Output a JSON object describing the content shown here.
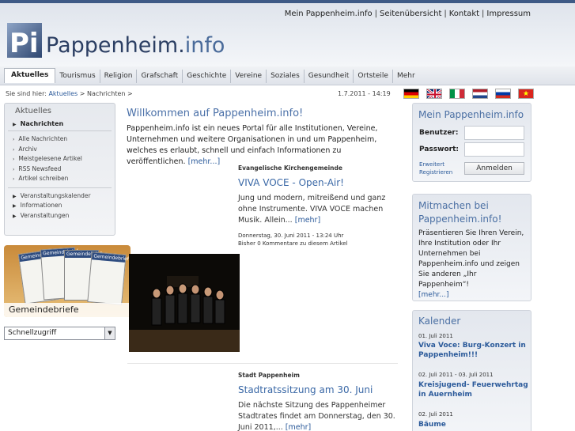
{
  "top_links": [
    "Mein Pappenheim.info",
    "Seitenübersicht",
    "Kontakt",
    "Impressum"
  ],
  "logo": {
    "mark": "Pi",
    "name": "Pappenheim",
    "dot": ".",
    "tld": "info"
  },
  "nav": {
    "tabs": [
      "Aktuelles",
      "Tourismus",
      "Religion",
      "Grafschaft",
      "Geschichte",
      "Vereine",
      "Soziales",
      "Gesundheit",
      "Ortsteile",
      "Mehr"
    ],
    "active": "Aktuelles"
  },
  "breadcrumb": {
    "prefix": "Sie sind hier:",
    "link": "Aktuelles",
    "sep": ">",
    "current": "Nachrichten",
    "trail": ">"
  },
  "datetime": "1.7.2011 - 14:19",
  "flags": [
    "german-flag",
    "english-flag",
    "italian-flag",
    "dutch-flag",
    "russian-flag",
    "vietnamese-flag"
  ],
  "left_menu": {
    "title": "Aktuelles",
    "active_item": "Nachrichten",
    "group1": [
      "Alle Nachrichten",
      "Archiv",
      "Meistgelesene Artikel",
      "RSS Newsfeed",
      "Artikel schreiben"
    ],
    "group2": [
      "Veranstaltungskalender",
      "Informationen",
      "Veranstaltungen"
    ]
  },
  "gemeindebriefe": {
    "label": "Gemeindebriefe",
    "brochure_title": "Gemeindebrief"
  },
  "schnellzugriff": {
    "value": "Schnellzugriff"
  },
  "welcome": {
    "title": "Willkommen auf Pappenheim.info!",
    "text": "Pappenheim.info ist ein neues Portal für alle Institutionen, Vereine, Unternehmen und weitere Organisationen in und um Pappenheim, welches es erlaubt, schnell und einfach Informationen zu veröffentlichen.",
    "more": "[mehr...]"
  },
  "articles": [
    {
      "category": "Evangelische Kirchengemeinde",
      "title": "VIVA VOCE - Open-Air!",
      "body": "Jung und modern, mitreißend und ganz ohne Instrumente. VIVA VOCE machen Musik. Allein...",
      "more": "[mehr]",
      "meta_date": "Donnerstag, 30. Juni 2011 - 13:24 Uhr",
      "meta_comments": "Bisher 0 Kommentare zu diesem Artikel"
    },
    {
      "category": "Stadt Pappenheim",
      "title": "Stadtratssitzung am 30. Juni",
      "body": "Die nächste Sitzung des Pappenheimer Stadtrates findet am Donnerstag, den 30. Juni 2011,...",
      "more": "[mehr]"
    }
  ],
  "login": {
    "title": "Mein Pappenheim.info",
    "user_label": "Benutzer:",
    "pass_label": "Passwort:",
    "link_extended": "Erweitert",
    "link_register": "Registrieren",
    "button": "Anmelden"
  },
  "mitmachen": {
    "title": "Mitmachen bei Pappenheim.info!",
    "text": "Präsentieren Sie Ihren Verein, Ihre Institution oder Ihr Unternehmen bei Pappenheim.info und zeigen Sie anderen „Ihr Pappenheim“!",
    "more": "[mehr...]"
  },
  "kalender": {
    "title": "Kalender",
    "events": [
      {
        "date": "01. Juli 2011",
        "title": "Viva Voce: Burg-Konzert in Pappenheim!!!"
      },
      {
        "date": "02. Juli 2011 - 03. Juli 2011",
        "title": "Kreisjugend- Feuerwehrtag in Auernheim"
      },
      {
        "date": "02. Juli 2011",
        "title": "Bäume"
      }
    ]
  }
}
